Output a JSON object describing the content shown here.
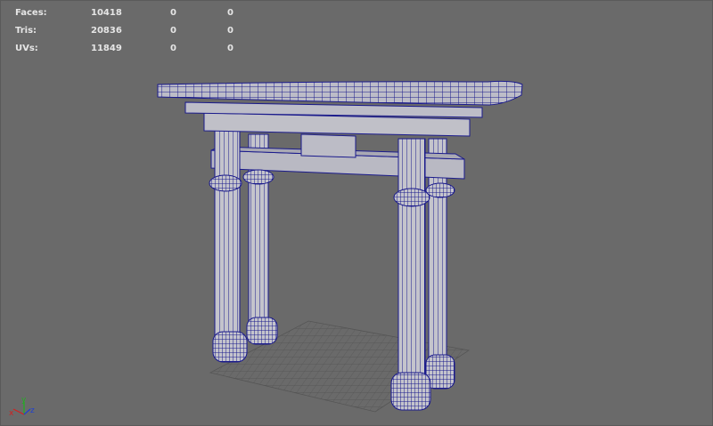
{
  "hud": {
    "rows": [
      {
        "label": "Faces:",
        "values": [
          "10418",
          "0",
          "0"
        ]
      },
      {
        "label": "Tris:",
        "values": [
          "20836",
          "0",
          "0"
        ]
      },
      {
        "label": "UVs:",
        "values": [
          "11849",
          "0",
          "0"
        ]
      }
    ]
  },
  "axes": {
    "x": "x",
    "y": "y",
    "z": "z"
  },
  "colors": {
    "viewport_bg": "#6a6a6a",
    "wire": "#1a1a8c",
    "mesh_fill": "#b9b9c3",
    "grid": "#555555",
    "hud_text": "#e6e6e6",
    "axis_x": "#d02020",
    "axis_y": "#20b020",
    "axis_z": "#2040d0"
  }
}
